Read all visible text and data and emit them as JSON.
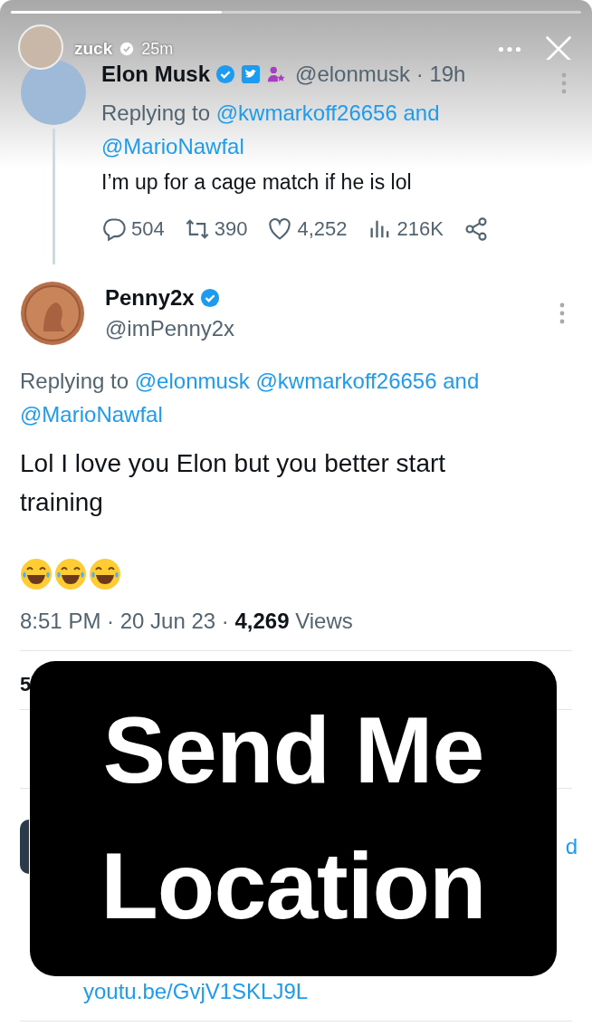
{
  "story": {
    "progress": {
      "level": 0.37
    },
    "user": "zuck",
    "verified": true,
    "time": "25m"
  },
  "quoted_tweet": {
    "name": "Elon Musk",
    "verified": true,
    "handle": "@elonmusk · 19h",
    "replying_prefix": "Replying to ",
    "replying_to": [
      "@kwmarkoff26656"
    ],
    "replying_joiner": " and ",
    "replying_last": "@MarioNawfal",
    "text": "I’m up for a cage match if he is lol",
    "actions": [
      {
        "kind": "reply",
        "count": "504"
      },
      {
        "kind": "retweet",
        "count": "390"
      },
      {
        "kind": "like",
        "count": "4,252"
      },
      {
        "kind": "views",
        "count": "216K"
      },
      {
        "kind": "share"
      }
    ]
  },
  "main_tweet": {
    "name": "Penny2x",
    "verified": true,
    "handle": "@imPenny2x",
    "replying_prefix": "Replying to ",
    "replying_to": [
      "@elonmusk",
      "@kwmarkoff26656"
    ],
    "replying_joiner": " and ",
    "replying_last": "@MarioNawfal",
    "text": "Lol I love you Elon but you better start training",
    "emojis": [
      {
        "kind": "laughing"
      },
      {
        "kind": "laughing"
      },
      {
        "kind": "laughing"
      }
    ],
    "time": "8:51 PM · 20 Jun 23 · ",
    "views_count": "4,269",
    "views_label": " Views"
  },
  "hidden_fragments": {
    "stat": "5",
    "reply_fragment": "d",
    "link": "youtu.be/GvjV1SKLJ9L"
  },
  "sticker": {
    "lines": [
      "Send Me",
      "Location"
    ]
  }
}
